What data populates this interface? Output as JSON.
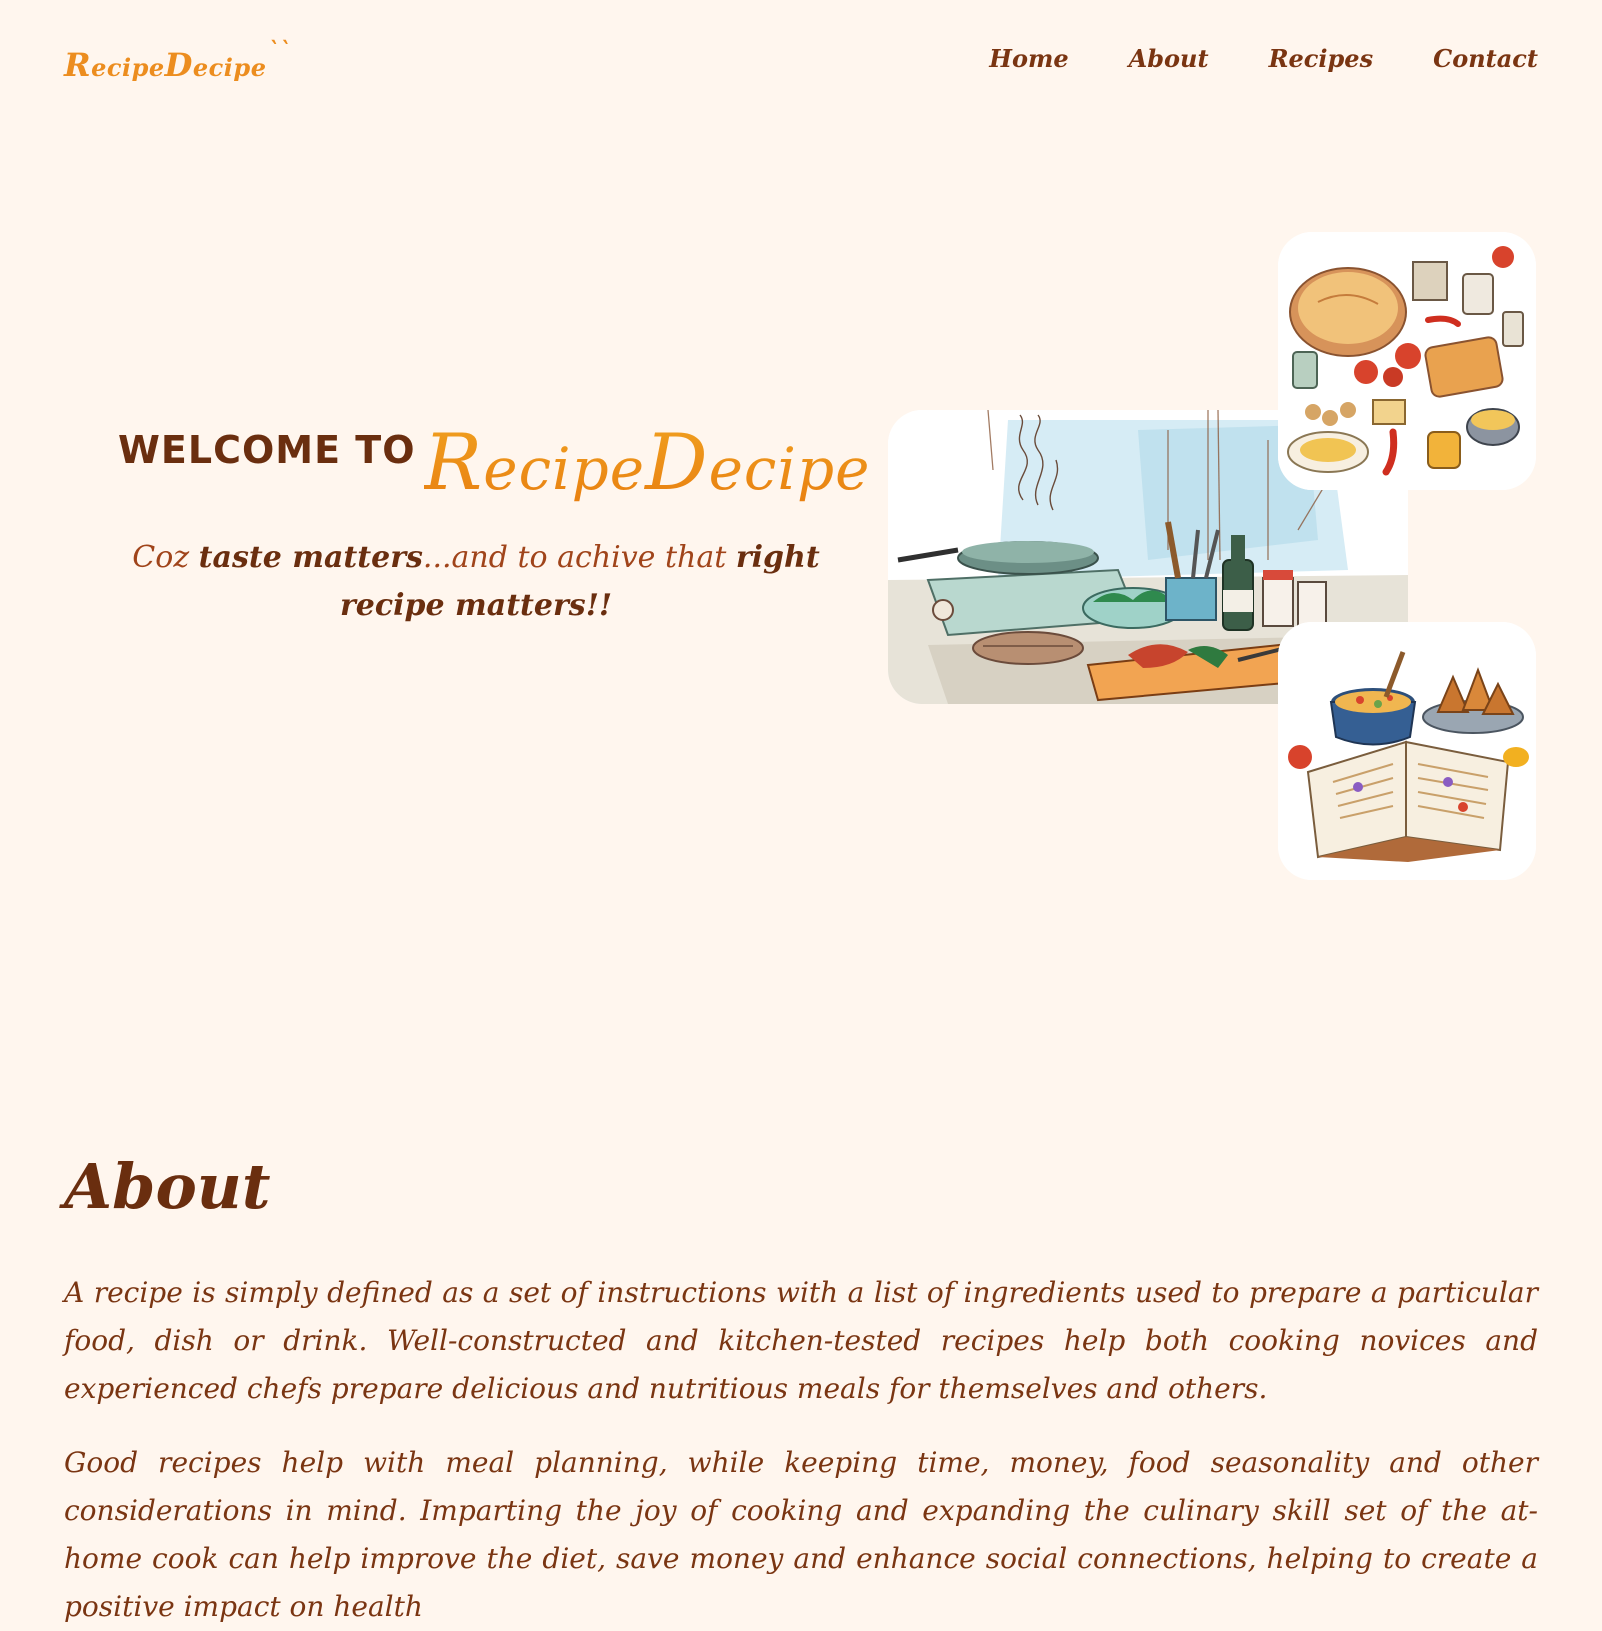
{
  "header": {
    "logo": {
      "recipe_big_letter": "R",
      "recipe_rest": "ecipe",
      "decipe_big_letter": "D",
      "decipe_rest": "ecipe",
      "tick": "``"
    },
    "nav": {
      "home": "Home",
      "about": "About",
      "recipes": "Recipes",
      "contact": "Contact"
    }
  },
  "hero": {
    "welcome": "WELCOME TO",
    "brand": {
      "recipe_big_letter": "R",
      "recipe_rest": "ecipe",
      "decipe_big_letter": "D",
      "decipe_rest": "ecipe"
    },
    "tagline": {
      "part1": "Coz ",
      "bold1": "taste matters",
      "part2": "...and to achive that ",
      "bold2": "right recipe matters!!"
    }
  },
  "about": {
    "heading": "About",
    "paragraph1": "A recipe is simply defined as a set of instructions with a list of ingredients used to prepare a particular food, dish or drink. Well-constructed and kitchen-tested recipes help both cooking novices and experienced chefs prepare delicious and nutritious meals for themselves and others.",
    "paragraph2": "Good recipes help with meal planning, while keeping time, money, food seasonality and other considerations in mind. Imparting the joy of cooking and expanding the culinary skill set of the at-home cook can help improve the diet, save money and enhance social connections, helping to create a positive impact on health"
  },
  "colors": {
    "background": "#fff6ee",
    "brand_orange": "#ec8d1f",
    "brown_dark": "#6a2e0f",
    "brown_text": "#7a3512"
  }
}
